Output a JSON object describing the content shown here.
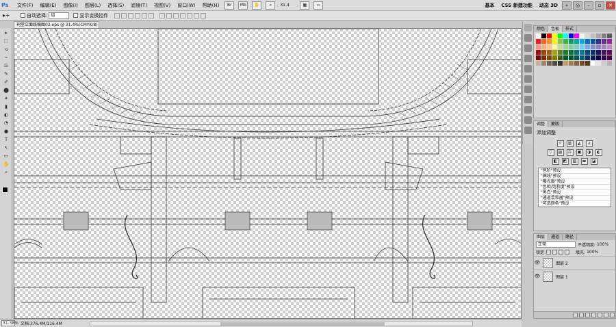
{
  "menubar": {
    "logo": "Ps",
    "items": [
      "文件(F)",
      "编辑(E)",
      "图像(I)",
      "图层(L)",
      "选择(S)",
      "滤镜(T)",
      "视图(V)",
      "窗口(W)",
      "帮助(H)"
    ],
    "zoom": "31.4",
    "workspaces": [
      "基本",
      "CSS 新建功能",
      "动态 3D"
    ],
    "expand": "»"
  },
  "options": {
    "tool_symbol": "▸+",
    "auto_select_label": "自动选择:",
    "auto_select_value": "组",
    "show_transform_label": "显示变换控件"
  },
  "document": {
    "tab_title": "祠堂立面线稿图02.eps @ 31.4%(CMYK/8) *"
  },
  "status": {
    "zoom": "31.38%",
    "doc_size": "文档:376.4M/116.4M"
  },
  "tools": [
    "▸",
    "⬚",
    "ᓀ",
    "⌁",
    "⊡",
    "✎",
    "✐",
    "⬤",
    "✦",
    "▮",
    "◐",
    "◔",
    "●",
    "T",
    "↖",
    "▭",
    "✋",
    "⌕"
  ],
  "swatches": {
    "tabs": [
      "颜色",
      "色板",
      "样式"
    ],
    "colors": [
      "#ffffff",
      "#000000",
      "#ff0000",
      "#ffff00",
      "#00ff00",
      "#00ffff",
      "#0000ff",
      "#ff00ff",
      "#f2f2f2",
      "#d9d9d9",
      "#bfbfbf",
      "#a6a6a6",
      "#808080",
      "#595959",
      "#ed1c24",
      "#f26522",
      "#f7941d",
      "#fff200",
      "#8dc63f",
      "#39b54a",
      "#00a651",
      "#00a99d",
      "#00aeef",
      "#0072bc",
      "#0054a6",
      "#2e3192",
      "#662d91",
      "#92278f",
      "#f69679",
      "#f9ad81",
      "#fdc68a",
      "#fff799",
      "#c4df9b",
      "#a3d39c",
      "#82ca9c",
      "#7accc8",
      "#6dcff6",
      "#7da7d9",
      "#8393ca",
      "#8781bd",
      "#a186be",
      "#bd8cbf",
      "#9e0b0f",
      "#a0410d",
      "#a36209",
      "#aba000",
      "#598527",
      "#1a7b30",
      "#007236",
      "#00746b",
      "#0076a3",
      "#004a80",
      "#003471",
      "#1b1464",
      "#440e62",
      "#630460",
      "#790000",
      "#7b2e00",
      "#7d4900",
      "#827b00",
      "#406618",
      "#005e20",
      "#005826",
      "#005952",
      "#005b7f",
      "#003663",
      "#002157",
      "#0d004c",
      "#32004b",
      "#4b0049",
      "#c7b299",
      "#998675",
      "#736357",
      "#534741",
      "#37302d",
      "#c69c6d",
      "#a67c52",
      "#8c6239",
      "#754c24",
      "#603913",
      "#ffffff",
      "#e6e6e6",
      "#cccccc",
      "#b3b3b3"
    ]
  },
  "adjustments": {
    "tabs": [
      "调整",
      "蒙版"
    ],
    "title": "添加调整",
    "row1": [
      "☼",
      "▥",
      "◭",
      "⊿"
    ],
    "row2": [
      "▽",
      "▤",
      "⚖",
      "▣",
      "◑",
      "◐"
    ],
    "row3": [
      "◧",
      "◩",
      "▨",
      "▬",
      "◪"
    ],
    "presets": [
      "\"色阶\"预设",
      "\"曲线\"预设",
      "\"曝光度\"预设",
      "\"色相/饱和度\"预设",
      "\"黑白\"预设",
      "\"通道混和器\"预设",
      "\"可选颜色\"预设"
    ]
  },
  "layers": {
    "tabs": [
      "图层",
      "通道",
      "路径"
    ],
    "blend_mode": "正常",
    "opacity_label": "不透明度:",
    "opacity_value": "100%",
    "lock_label": "锁定:",
    "fill_label": "填充:",
    "fill_value": "100%",
    "items": [
      {
        "name": "图层 2",
        "visible_icon": "👁"
      },
      {
        "name": "图层 1",
        "visible_icon": "👁"
      }
    ]
  }
}
